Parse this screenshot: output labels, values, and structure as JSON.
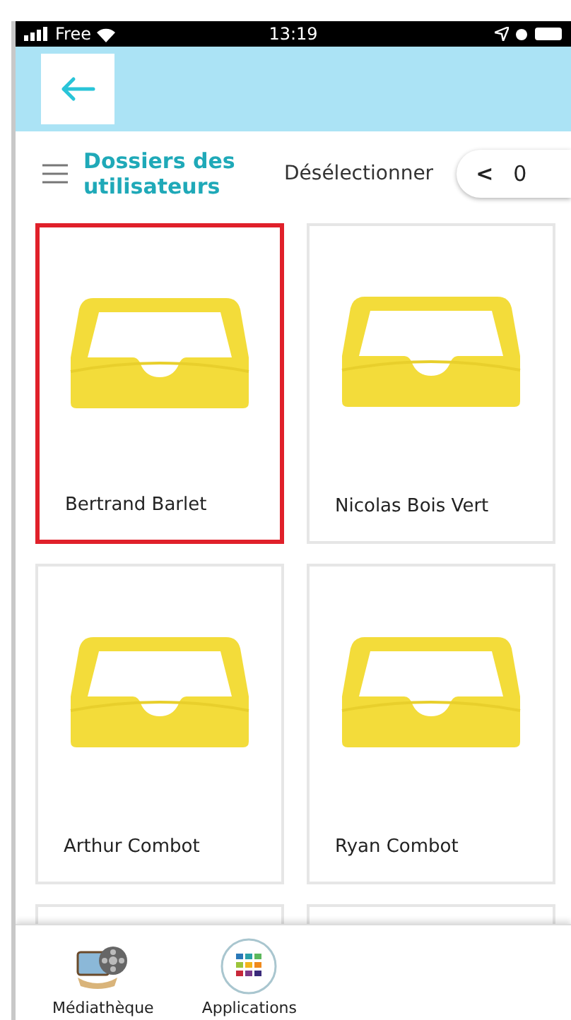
{
  "status_bar": {
    "carrier": "Free",
    "time": "13:19"
  },
  "header": {
    "title": "Dossiers des utilisateurs",
    "deselect": "Désélectionner",
    "pager_prev": "<",
    "pager_count": "0"
  },
  "folders": [
    {
      "name": "Bertrand Barlet",
      "selected": true
    },
    {
      "name": "Nicolas Bois Vert",
      "selected": false
    },
    {
      "name": "Arthur Combot",
      "selected": false
    },
    {
      "name": "Ryan Combot",
      "selected": false
    }
  ],
  "bottom_nav": [
    {
      "kind": "media",
      "label": "Médiathèque"
    },
    {
      "kind": "apps",
      "label": "Applications"
    }
  ]
}
